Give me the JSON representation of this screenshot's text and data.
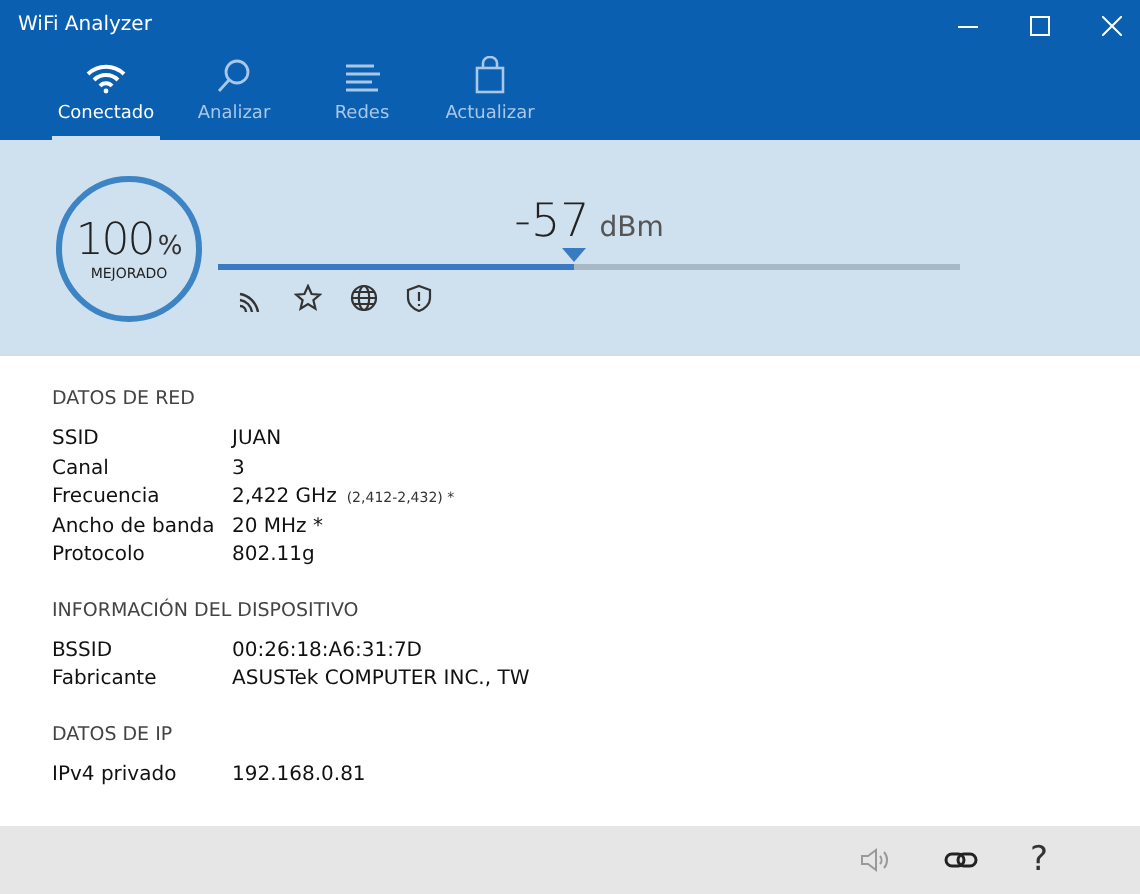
{
  "window": {
    "title": "WiFi Analyzer"
  },
  "tabs": [
    {
      "label": "Conectado",
      "kind": "wifi",
      "selected": true
    },
    {
      "label": "Analizar",
      "kind": "search",
      "selected": false
    },
    {
      "label": "Redes",
      "kind": "list",
      "selected": false
    },
    {
      "label": "Actualizar",
      "kind": "bag",
      "selected": false
    }
  ],
  "signal": {
    "quality": "100",
    "unit": "%",
    "rating": "MEJORADO",
    "reading": "-57",
    "reading_unit": "dBm",
    "level": 0.48
  },
  "sections": [
    {
      "title": "DATOS DE RED",
      "rows": [
        {
          "label": "SSID",
          "value": "JUAN"
        },
        {
          "label": "Canal",
          "value": "3"
        },
        {
          "label": "Frecuencia",
          "value": "2,422 GHz",
          "note": "(2,412-2,432) *"
        },
        {
          "label": "Ancho de banda",
          "value": "20 MHz *"
        },
        {
          "label": "Protocolo",
          "value": "802.11g"
        }
      ]
    },
    {
      "title": "INFORMACIÓN DEL DISPOSITIVO",
      "rows": [
        {
          "label": "BSSID",
          "value": "00:26:18:A6:31:7D"
        },
        {
          "label": "Fabricante",
          "value": "ASUSTek COMPUTER INC., TW"
        }
      ]
    },
    {
      "title": "DATOS DE IP",
      "rows": [
        {
          "label": "IPv4 privado",
          "value": "192.168.0.81"
        }
      ]
    }
  ],
  "bottom_bar": {
    "help": "?"
  }
}
